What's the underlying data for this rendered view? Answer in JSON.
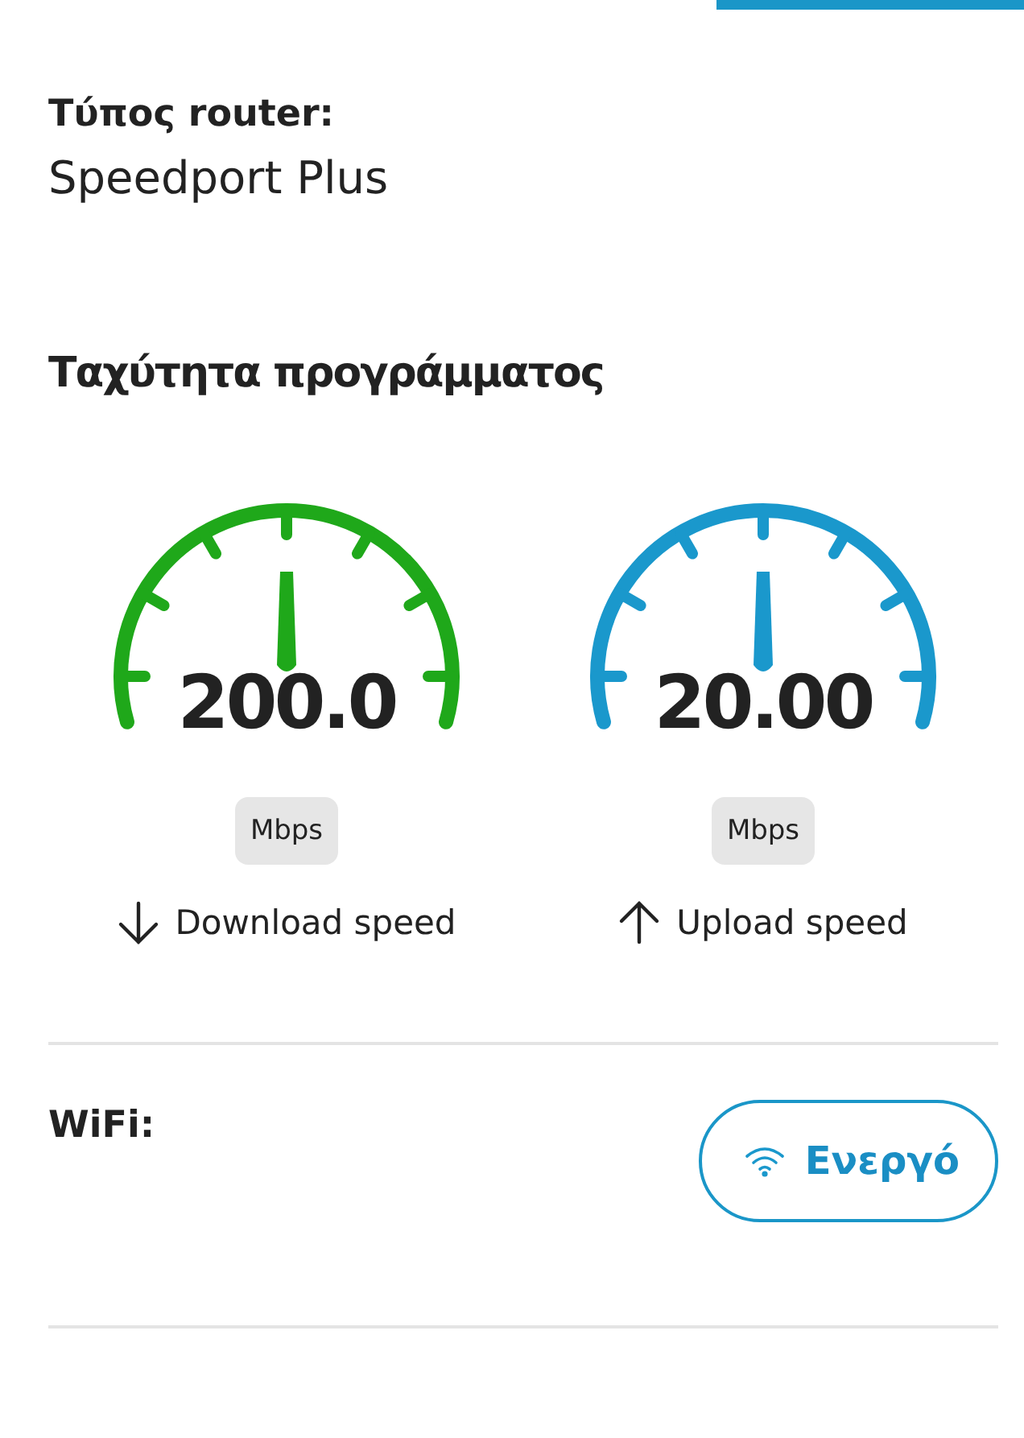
{
  "tab_indicator": {
    "selected": true
  },
  "router_type": {
    "label": "Τύπος router:",
    "value": "Speedport Plus"
  },
  "program_speed": {
    "title": "Ταχύτητα προγράμματος",
    "gauges": [
      {
        "kind": "download",
        "value": "200.0",
        "unit": "Mbps",
        "label": "Download speed",
        "color": "#1fa81a"
      },
      {
        "kind": "upload",
        "value": "20.00",
        "unit": "Mbps",
        "label": "Upload speed",
        "color": "#1a98cc"
      }
    ]
  },
  "wifi": {
    "label": "WiFi:",
    "status": "Ενεργό",
    "on": true
  }
}
